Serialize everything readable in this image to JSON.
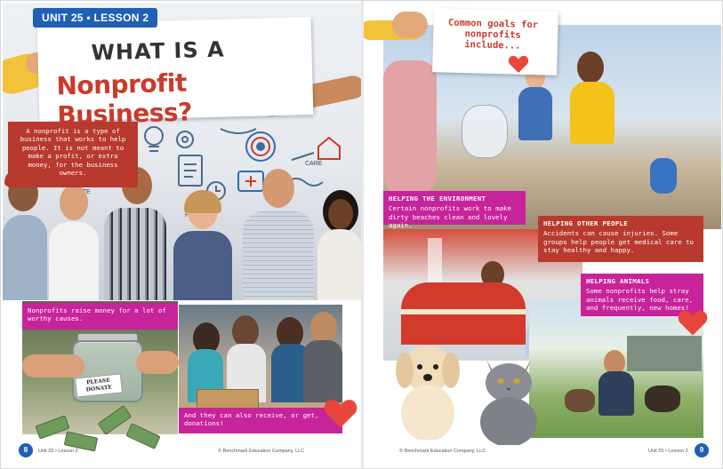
{
  "left_page": {
    "unit_tag": "UNIT 25 • LESSON 2",
    "title_line1": "WHAT IS A",
    "title_line2": "Nonprofit Business?",
    "definition": "A nonprofit is a type of business that works to help people. It is not meant to make a profit, or extra money, for the business owners.",
    "doodle_labels": [
      "DONATE",
      "CARE",
      "HELP"
    ],
    "caption_raise": "Nonprofits raise money for a lot of worthy causes.",
    "caption_receive": "And they can also receive, or get, donations!",
    "jar_label": "PLEASE DONATE",
    "page_number": "8",
    "footer_unit": "Unit 25 • Lesson 2",
    "footer_copyright": "© Benchmark Education Company, LLC"
  },
  "right_page": {
    "goals_card": "Common goals for nonprofits include...",
    "environment": {
      "heading": "HELPING THE ENVIRONMENT",
      "text": "Certain nonprofits work to make dirty beaches clean and lovely again."
    },
    "people": {
      "heading": "HELPING OTHER PEOPLE",
      "text": "Accidents can cause injuries. Some groups help people get medical care to stay healthy and happy."
    },
    "animals": {
      "heading": "HELPING ANIMALS",
      "text": "Some nonprofits help stray animals receive food, care, and frequently, new homes!"
    },
    "page_number": "9",
    "footer_unit": "Unit 25 • Lesson 2",
    "footer_copyright": "© Benchmark Education Company, LLC"
  },
  "colors": {
    "unit_blue": "#1f5fb4",
    "title_red": "#c93a2a",
    "box_red": "#b8392e",
    "box_magenta": "#c7239a",
    "heart_red": "#e8463a"
  },
  "icons": [
    "heart-icon",
    "light-bulb-icon",
    "gear-icon",
    "target-icon",
    "clipboard-icon",
    "medical-kit-icon",
    "handshake-icon",
    "house-icon",
    "clock-icon"
  ]
}
